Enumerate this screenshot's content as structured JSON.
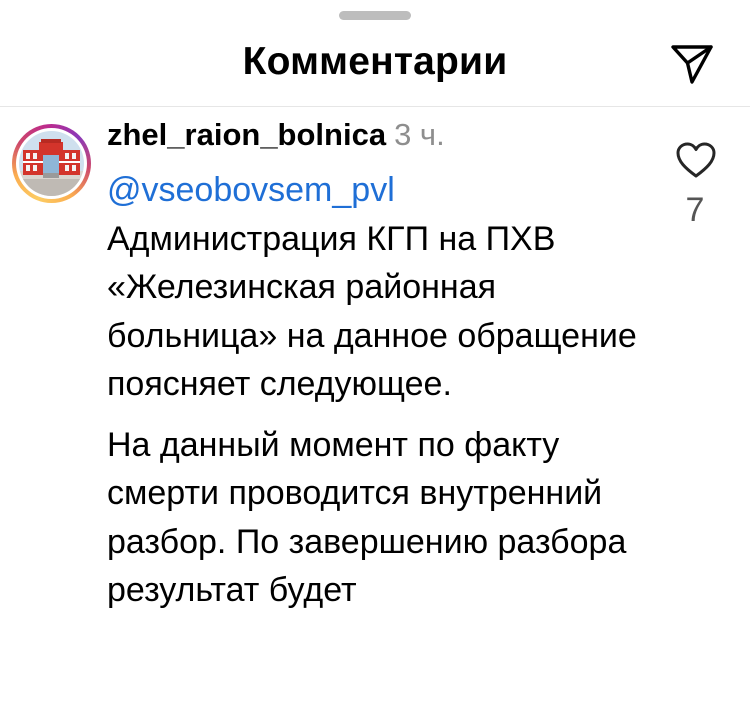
{
  "header": {
    "title": "Комментарии",
    "share_icon": "paper-plane-icon"
  },
  "comment": {
    "username": "zhel_raion_bolnica",
    "time": "3 ч.",
    "mention": "@vseobovsem_pvl",
    "paragraph1": "Администрация КГП на ПХВ «Железинская районная больница» на данное обращение поясняет следующее.",
    "paragraph2": "На данный момент по факту смерти проводится внутренний разбор. По завершению разбора результат будет",
    "like_icon": "heart-outline-icon",
    "like_count": "7",
    "avatar_icon": "hospital-building-avatar"
  },
  "colors": {
    "mention": "#1f6fd6",
    "timestamp": "#8e8e8e",
    "divider": "#e6e6e6",
    "grabber": "#bdbdbd"
  }
}
